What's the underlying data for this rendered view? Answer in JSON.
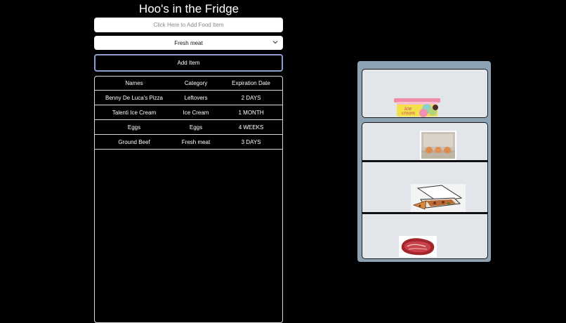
{
  "app": {
    "title": "Hoo's in the Fridge"
  },
  "form": {
    "food_placeholder": "Click Here to Add Food Item",
    "category_selected": "Fresh meat",
    "add_button_label": "Add Item"
  },
  "table": {
    "headers": [
      "Names",
      "Category",
      "Expiration Date"
    ],
    "rows": [
      [
        "Benny De Luca's Pizza",
        "Leftovers",
        "2 DAYS"
      ],
      [
        "Talenti Ice Cream",
        "Ice Cream",
        "1 MONTH"
      ],
      [
        "Eggs",
        "Eggs",
        "4 WEEKS"
      ],
      [
        "Ground Beef",
        "Fresh meat",
        "3 DAYS"
      ]
    ]
  },
  "fridge": {
    "items": [
      "ice-cream",
      "eggs",
      "pizza",
      "steak"
    ],
    "ice_cream_label_line1": "ice",
    "ice_cream_label_line2": "cream"
  },
  "colors": {
    "background": "#000000",
    "fridge_frame": "#8da2b2",
    "shelf": "#e2e5ea",
    "button_border": "#8f9fd3"
  }
}
